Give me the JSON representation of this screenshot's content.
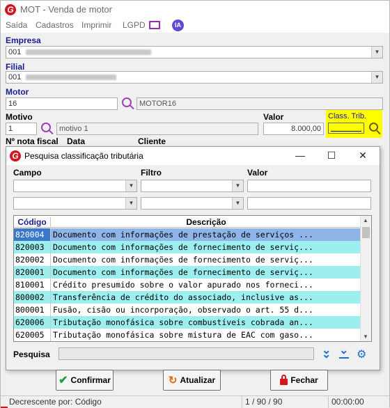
{
  "window": {
    "title": "MOT - Venda de motor"
  },
  "menu": {
    "items": [
      "Saída",
      "Cadastros",
      "Imprimir",
      "LGPD"
    ],
    "ia_label": "IA"
  },
  "form": {
    "empresa_label": "Empresa",
    "empresa_value": "001",
    "filial_label": "Filial",
    "filial_value": "001",
    "motor_label": "Motor",
    "motor_value": "16",
    "motor_desc": "MOTOR16",
    "motivo_label": "Motivo",
    "motivo_value": "1",
    "motivo_desc": "motivo 1",
    "valor_label": "Valor",
    "valor_value": "8.000,00",
    "class_trib_label": "Class. Trib.",
    "class_trib_value": "",
    "nota_fiscal_label": "Nº nota fiscal",
    "data_label": "Data",
    "cliente_label": "Cliente"
  },
  "dialog": {
    "title": "Pesquisa classificação tributária",
    "campo_label": "Campo",
    "filtro_label": "Filtro",
    "valor_label": "Valor",
    "grid": {
      "headers": {
        "codigo": "Código",
        "descricao": "Descrição"
      },
      "rows": [
        {
          "codigo": "820004",
          "descricao": "Documento com informações de prestação de serviços ...",
          "style": "selected"
        },
        {
          "codigo": "820003",
          "descricao": "Documento com informações de fornecimento de serviç...",
          "style": "alt"
        },
        {
          "codigo": "820002",
          "descricao": "Documento com informações de fornecimento de serviç...",
          "style": "normal"
        },
        {
          "codigo": "820001",
          "descricao": "Documento com informações de fornecimento de serviç...",
          "style": "alt"
        },
        {
          "codigo": "810001",
          "descricao": "Crédito presumido sobre o valor apurado nos forneci...",
          "style": "normal"
        },
        {
          "codigo": "800002",
          "descricao": "Transferência de crédito do associado, inclusive as...",
          "style": "alt"
        },
        {
          "codigo": "800001",
          "descricao": "Fusão, cisão ou incorporação, observado o art. 55 d...",
          "style": "normal"
        },
        {
          "codigo": "620006",
          "descricao": "Tributação monofásica sobre combustíveis cobrada an...",
          "style": "alt"
        },
        {
          "codigo": "620005",
          "descricao": "Tributação monofásica sobre mistura de EAC com gaso...",
          "style": "normal"
        }
      ]
    },
    "pesquisa_label": "Pesquisa",
    "buttons": {
      "confirmar": "Confirmar",
      "atualizar": "Atualizar",
      "fechar": "Fechar"
    }
  },
  "status": {
    "order": "Decrescente por: Código",
    "position": "1 / 90 / 90",
    "time": "00:00:00"
  },
  "colors": {
    "selected": "#8fb4e8",
    "alt": "#9deeee",
    "highlight": "#ffff00",
    "label": "#1b1b91"
  }
}
